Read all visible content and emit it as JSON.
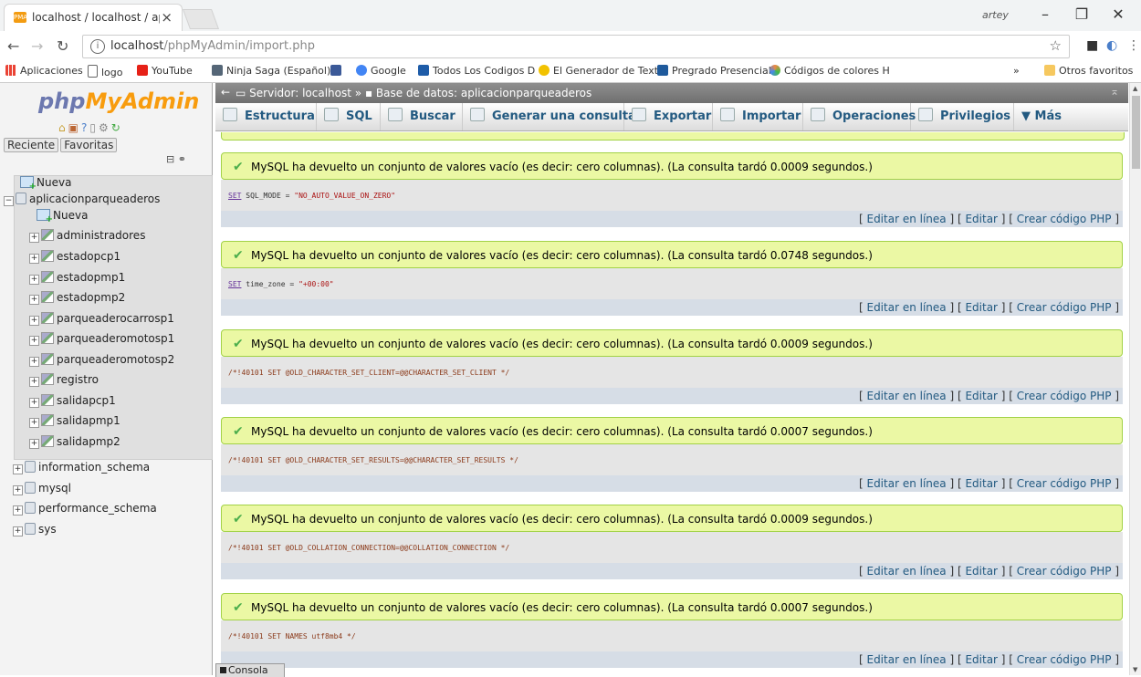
{
  "browser": {
    "tab_title": "localhost / localhost / ap",
    "tab_favicon": "PMA",
    "user": "artey",
    "url_host": "localhost",
    "url_path": "/phpMyAdmin/import.php",
    "bookmarks": [
      {
        "label": "Aplicaciones",
        "color": "#ea4335"
      },
      {
        "label": "logo",
        "color": "#ffffff"
      },
      {
        "label": "YouTube",
        "color": "#e62117"
      },
      {
        "label": "Ninja Saga (Español)",
        "color": "#556677"
      },
      {
        "label": "",
        "color": "#3b5998"
      },
      {
        "label": "Google",
        "color": "#4285f4"
      },
      {
        "label": "Todos Los Codigos D",
        "color": "#1e5ca8"
      },
      {
        "label": "El Generador de Text",
        "color": "#f2c200"
      },
      {
        "label": "Pregrado Presencial",
        "color": "#1f5a9c"
      },
      {
        "label": "Códigos de colores H",
        "color": "#e86a1d"
      }
    ],
    "bookmarks_more": "»",
    "other_bookmarks": "Otros favoritos"
  },
  "nav": {
    "logo_php": "php",
    "logo_myadmin": "MyAdmin",
    "tabs": [
      "Reciente",
      "Favoritas"
    ],
    "tree": [
      {
        "label": "Nueva",
        "level": 0,
        "type": "new"
      },
      {
        "label": "aplicacionparqueaderos",
        "level": 0,
        "type": "db",
        "expanded": true
      },
      {
        "label": "Nueva",
        "level": 1,
        "type": "new"
      },
      {
        "label": "administradores",
        "level": 1,
        "type": "table"
      },
      {
        "label": "estadopcp1",
        "level": 1,
        "type": "table"
      },
      {
        "label": "estadopmp1",
        "level": 1,
        "type": "table"
      },
      {
        "label": "estadopmp2",
        "level": 1,
        "type": "table"
      },
      {
        "label": "parqueaderocarrosp1",
        "level": 1,
        "type": "table"
      },
      {
        "label": "parqueaderomotosp1",
        "level": 1,
        "type": "table"
      },
      {
        "label": "parqueaderomotosp2",
        "level": 1,
        "type": "table"
      },
      {
        "label": "registro",
        "level": 1,
        "type": "table"
      },
      {
        "label": "salidapcp1",
        "level": 1,
        "type": "table"
      },
      {
        "label": "salidapmp1",
        "level": 1,
        "type": "table"
      },
      {
        "label": "salidapmp2",
        "level": 1,
        "type": "table"
      },
      {
        "label": "information_schema",
        "level": 0,
        "type": "db"
      },
      {
        "label": "mysql",
        "level": 0,
        "type": "db"
      },
      {
        "label": "performance_schema",
        "level": 0,
        "type": "db"
      },
      {
        "label": "sys",
        "level": 0,
        "type": "db"
      }
    ]
  },
  "breadcrumb": {
    "server_label": "Servidor: localhost",
    "sep": "»",
    "db_label": "Base de datos: aplicacionparqueaderos"
  },
  "menu": [
    "Estructura",
    "SQL",
    "Buscar",
    "Generar una consulta",
    "Exportar",
    "Importar",
    "Operaciones",
    "Privilegios",
    "Más"
  ],
  "results": [
    {
      "message": "MySQL ha devuelto un conjunto de valores vacío (es decir: cero columnas). (La consulta tardó 0.0009 segundos.)",
      "keyword": "SET",
      "rest": " SQL_MODE = ",
      "string": "\"NO_AUTO_VALUE_ON_ZERO\"",
      "comment": ""
    },
    {
      "message": "MySQL ha devuelto un conjunto de valores vacío (es decir: cero columnas). (La consulta tardó 0.0748 segundos.)",
      "keyword": "SET",
      "rest": " time_zone = ",
      "string": "\"+00:00\"",
      "comment": ""
    },
    {
      "message": "MySQL ha devuelto un conjunto de valores vacío (es decir: cero columnas). (La consulta tardó 0.0009 segundos.)",
      "keyword": "",
      "rest": "",
      "string": "",
      "comment": "/*!40101 SET @OLD_CHARACTER_SET_CLIENT=@@CHARACTER_SET_CLIENT */"
    },
    {
      "message": "MySQL ha devuelto un conjunto de valores vacío (es decir: cero columnas). (La consulta tardó 0.0007 segundos.)",
      "keyword": "",
      "rest": "",
      "string": "",
      "comment": "/*!40101 SET @OLD_CHARACTER_SET_RESULTS=@@CHARACTER_SET_RESULTS */"
    },
    {
      "message": "MySQL ha devuelto un conjunto de valores vacío (es decir: cero columnas). (La consulta tardó 0.0009 segundos.)",
      "keyword": "",
      "rest": "",
      "string": "",
      "comment": "/*!40101 SET @OLD_COLLATION_CONNECTION=@@COLLATION_CONNECTION */"
    },
    {
      "message": "MySQL ha devuelto un conjunto de valores vacío (es decir: cero columnas). (La consulta tardó 0.0007 segundos.)",
      "keyword": "",
      "rest": "",
      "string": "",
      "comment": "/*!40101 SET NAMES utf8mb4 */"
    }
  ],
  "result_links": {
    "inline": "Editar en línea",
    "edit": "Editar",
    "php": "Crear código PHP"
  },
  "console_label": "Consola"
}
